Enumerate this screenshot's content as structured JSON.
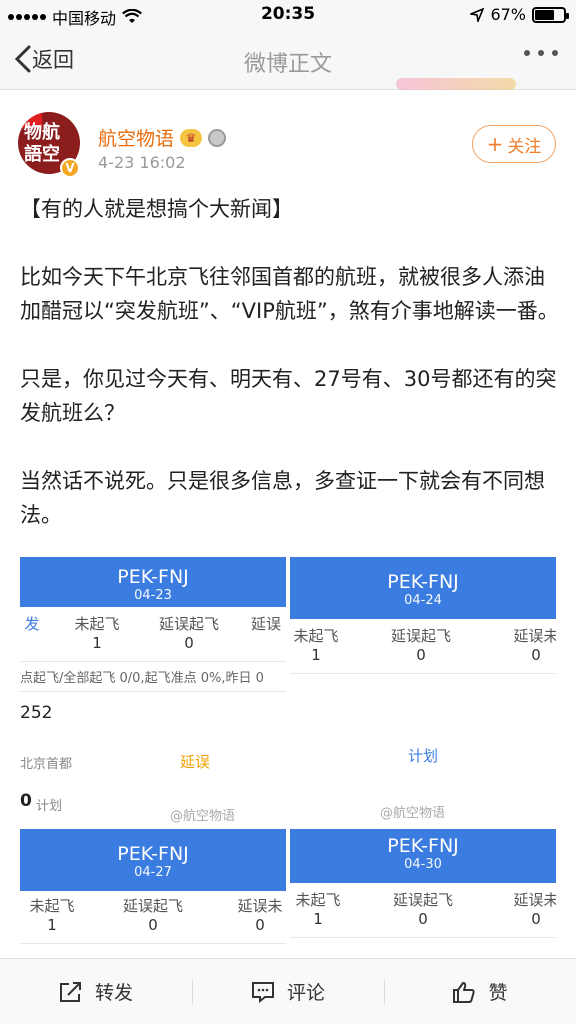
{
  "status_bar": {
    "carrier": "中国移动",
    "time": "20:35",
    "battery": "67%",
    "battery_level": 0.67
  },
  "nav": {
    "back_label": "返回",
    "title": "微博正文"
  },
  "post": {
    "author": "航空物语",
    "time": "4-23 16:02",
    "follow_label": "关注",
    "avatar_text": "物航語空",
    "paragraphs": [
      "【有的人就是想搞个大新闻】",
      "比如今天下午北京飞往邻国首都的航班，就被很多人添油加醋冠以“突发航班”、“VIP航班”，煞有介事地解读一番。",
      "只是，你见过今天有、明天有、27号有、30号都还有的突发航班么？",
      "当然话不说死。只是很多信息，多查证一下就会有不同想法。"
    ]
  },
  "cards": [
    {
      "route": "PEK-FNJ",
      "date": "04-23",
      "stats": [
        {
          "label": "发",
          "value": ""
        },
        {
          "label": "未起飞",
          "value": "1"
        },
        {
          "label": "延误起飞",
          "value": "0"
        },
        {
          "label": "延误",
          "value": "0"
        }
      ],
      "punctuality": "点起飞/全部起飞 0/0,起飞准点 0%,昨日 0",
      "flight_no": "252",
      "origin": "北京首都",
      "status": "延误",
      "plan_prefix": "0",
      "plan_label": "计划"
    },
    {
      "route": "PEK-FNJ",
      "date": "04-24",
      "stats": [
        {
          "label": "未起飞",
          "value": "1"
        },
        {
          "label": "延误起飞",
          "value": "0"
        },
        {
          "label": "延误未",
          "value": "0"
        }
      ],
      "plan_label": "计划"
    },
    {
      "route": "PEK-FNJ",
      "date": "04-27",
      "stats": [
        {
          "label": "未起飞",
          "value": "1"
        },
        {
          "label": "延误起飞",
          "value": "0"
        },
        {
          "label": "延误未",
          "value": "0"
        }
      ]
    },
    {
      "route": "PEK-FNJ",
      "date": "04-30",
      "stats": [
        {
          "label": "未起飞",
          "value": "1"
        },
        {
          "label": "延误起飞",
          "value": "0"
        },
        {
          "label": "延误未",
          "value": "0"
        }
      ]
    }
  ],
  "watermark": "@航空物语",
  "toolbar": {
    "repost": "转发",
    "comment": "评论",
    "like": "赞"
  }
}
